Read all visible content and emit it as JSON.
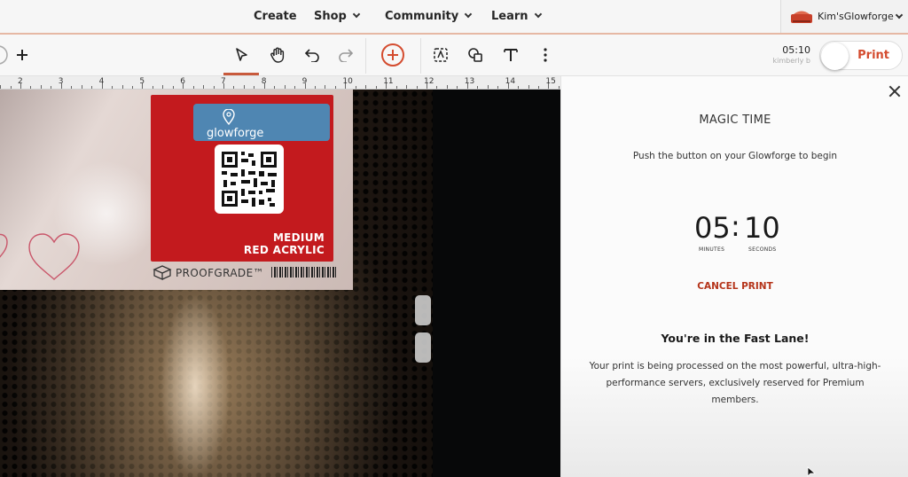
{
  "nav": {
    "items": [
      {
        "label": "Create"
      },
      {
        "label": "Shop"
      },
      {
        "label": "Community"
      },
      {
        "label": "Learn"
      }
    ],
    "account_name": "Kim'sGlowforge"
  },
  "toolbar": {
    "timer": "05:10",
    "timer_user": "kimberly b",
    "print_label": "Print"
  },
  "ruler": {
    "labels": [
      "2",
      "3",
      "4",
      "5",
      "6",
      "7",
      "8",
      "9",
      "10",
      "11",
      "12",
      "13",
      "14",
      "15"
    ]
  },
  "material": {
    "logo_text": "glowforge",
    "line1": "MEDIUM",
    "line2": "RED ACRYLIC",
    "brand": "PROOFGRADE™"
  },
  "panel": {
    "title": "MAGIC TIME",
    "subtitle": "Push the button on your Glowforge to begin",
    "minutes": "05",
    "seconds": "10",
    "minutes_label": "MINUTES",
    "seconds_label": "SECONDS",
    "cancel_label": "CANCEL PRINT",
    "fast_title": "You're in the Fast Lane!",
    "fast_body": "Your print is being processed on the most powerful, ultra-high-performance servers, exclusively reserved for Premium members."
  },
  "colors": {
    "accent": "#d44c2f",
    "cancel": "#b5341a",
    "sticker_red": "#c31a1e",
    "sticker_blue": "#4f86b2"
  },
  "icons": [
    "plus-icon",
    "select-arrow-icon",
    "hand-pan-icon",
    "undo-icon",
    "redo-icon",
    "add-circle-icon",
    "trace-icon",
    "shapes-icon",
    "text-icon",
    "more-vertical-icon",
    "close-icon",
    "glowforge-unit-icon"
  ]
}
